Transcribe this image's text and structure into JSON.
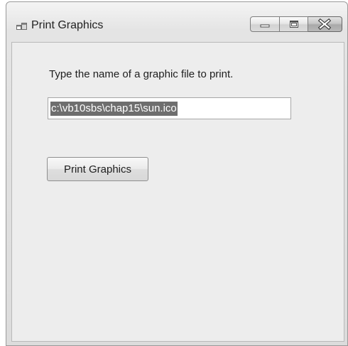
{
  "window": {
    "title": "Print Graphics",
    "icon": "app-window-icon",
    "caption_buttons": [
      "minimize-icon",
      "maximize-icon",
      "close-icon"
    ]
  },
  "form": {
    "prompt_label": "Type the name of a graphic file to print.",
    "file_input_value": "c:\\vb10sbs\\chap15\\sun.ico",
    "print_button_label": "Print Graphics"
  }
}
